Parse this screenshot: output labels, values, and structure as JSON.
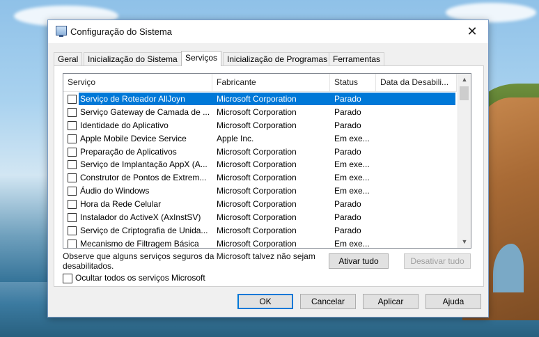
{
  "window": {
    "title": "Configuração do Sistema",
    "close_glyph": "✕"
  },
  "tabs": [
    {
      "label": "Geral",
      "active": false
    },
    {
      "label": "Inicialização do Sistema",
      "active": false
    },
    {
      "label": "Serviços",
      "active": true
    },
    {
      "label": "Inicialização de Programas",
      "active": false
    },
    {
      "label": "Ferramentas",
      "active": false
    }
  ],
  "services": {
    "columns": [
      "Serviço",
      "Fabricante",
      "Status",
      "Data da Desabili..."
    ],
    "rows": [
      {
        "name": "Serviço de Roteador AllJoyn",
        "maker": "Microsoft Corporation",
        "status": "Parado",
        "checked": false,
        "selected": true
      },
      {
        "name": "Serviço Gateway de Camada de ...",
        "maker": "Microsoft Corporation",
        "status": "Parado",
        "checked": false,
        "selected": false
      },
      {
        "name": "Identidade do Aplicativo",
        "maker": "Microsoft Corporation",
        "status": "Parado",
        "checked": false,
        "selected": false
      },
      {
        "name": "Apple Mobile Device Service",
        "maker": "Apple Inc.",
        "status": "Em exe...",
        "checked": false,
        "selected": false
      },
      {
        "name": "Preparação de Aplicativos",
        "maker": "Microsoft Corporation",
        "status": "Parado",
        "checked": false,
        "selected": false
      },
      {
        "name": "Serviço de Implantação AppX (A...",
        "maker": "Microsoft Corporation",
        "status": "Em exe...",
        "checked": false,
        "selected": false
      },
      {
        "name": "Construtor de Pontos de Extrem...",
        "maker": "Microsoft Corporation",
        "status": "Em exe...",
        "checked": false,
        "selected": false
      },
      {
        "name": "Áudio do Windows",
        "maker": "Microsoft Corporation",
        "status": "Em exe...",
        "checked": false,
        "selected": false
      },
      {
        "name": "Hora da Rede Celular",
        "maker": "Microsoft Corporation",
        "status": "Parado",
        "checked": false,
        "selected": false
      },
      {
        "name": "Instalador do ActiveX (AxInstSV)",
        "maker": "Microsoft Corporation",
        "status": "Parado",
        "checked": false,
        "selected": false
      },
      {
        "name": "Serviço de Criptografia de Unida...",
        "maker": "Microsoft Corporation",
        "status": "Parado",
        "checked": false,
        "selected": false
      },
      {
        "name": "Mecanismo de Filtragem Básica",
        "maker": "Microsoft Corporation",
        "status": "Em exe...",
        "checked": false,
        "selected": false
      }
    ]
  },
  "note": "Observe que alguns serviços seguros da Microsoft talvez não sejam desabilitados.",
  "enable_all": "Ativar tudo",
  "disable_all": "Desativar tudo",
  "hide_microsoft": {
    "label": "Ocultar todos os serviços Microsoft",
    "checked": false
  },
  "footer": {
    "ok": "OK",
    "cancel": "Cancelar",
    "apply": "Aplicar",
    "help": "Ajuda"
  },
  "colors": {
    "selection": "#0078d7",
    "dialog_bg": "#f0f0f0"
  }
}
